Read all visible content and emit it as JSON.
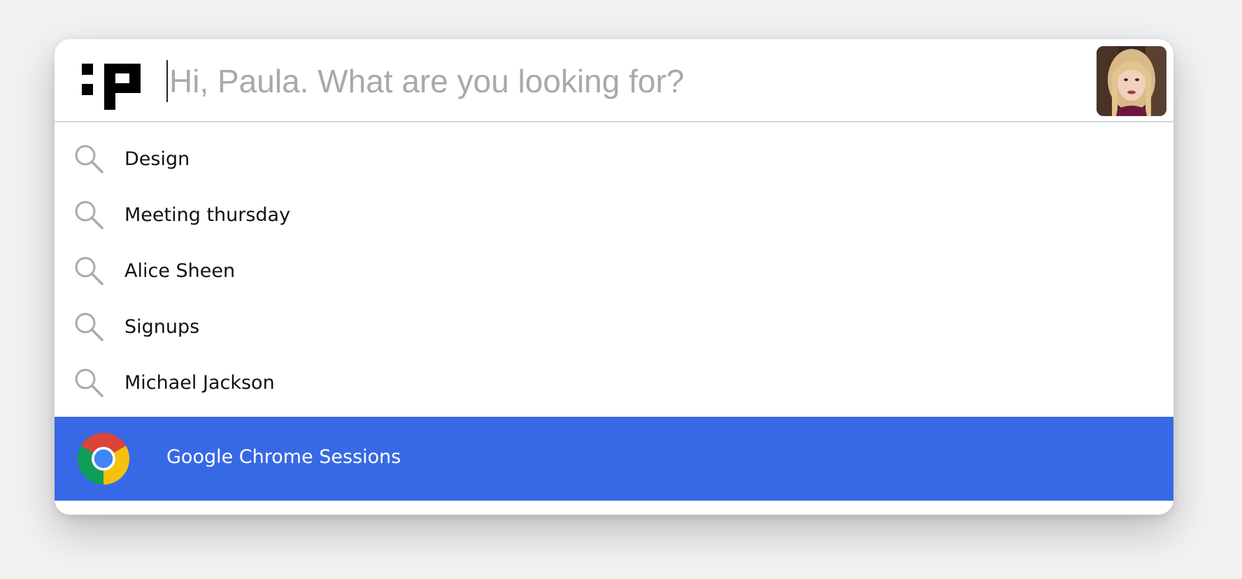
{
  "search": {
    "placeholder": "Hi, Paula. What are you looking for?",
    "value": ""
  },
  "icons": {
    "logo": "app-logo-icon",
    "avatar": "user-avatar",
    "suggestion": "search-icon",
    "result": "chrome-icon"
  },
  "suggestions": [
    {
      "label": "Design"
    },
    {
      "label": "Meeting thursday"
    },
    {
      "label": "Alice Sheen"
    },
    {
      "label": "Signups"
    },
    {
      "label": "Michael Jackson"
    }
  ],
  "result": {
    "label": "Google Chrome Sessions",
    "selected": true
  },
  "colors": {
    "accent": "#3769e6",
    "background": "#f2f2f2",
    "panel": "#ffffff",
    "placeholder": "#a9a9a9",
    "icon": "#aaaaaa",
    "text": "#111111"
  }
}
